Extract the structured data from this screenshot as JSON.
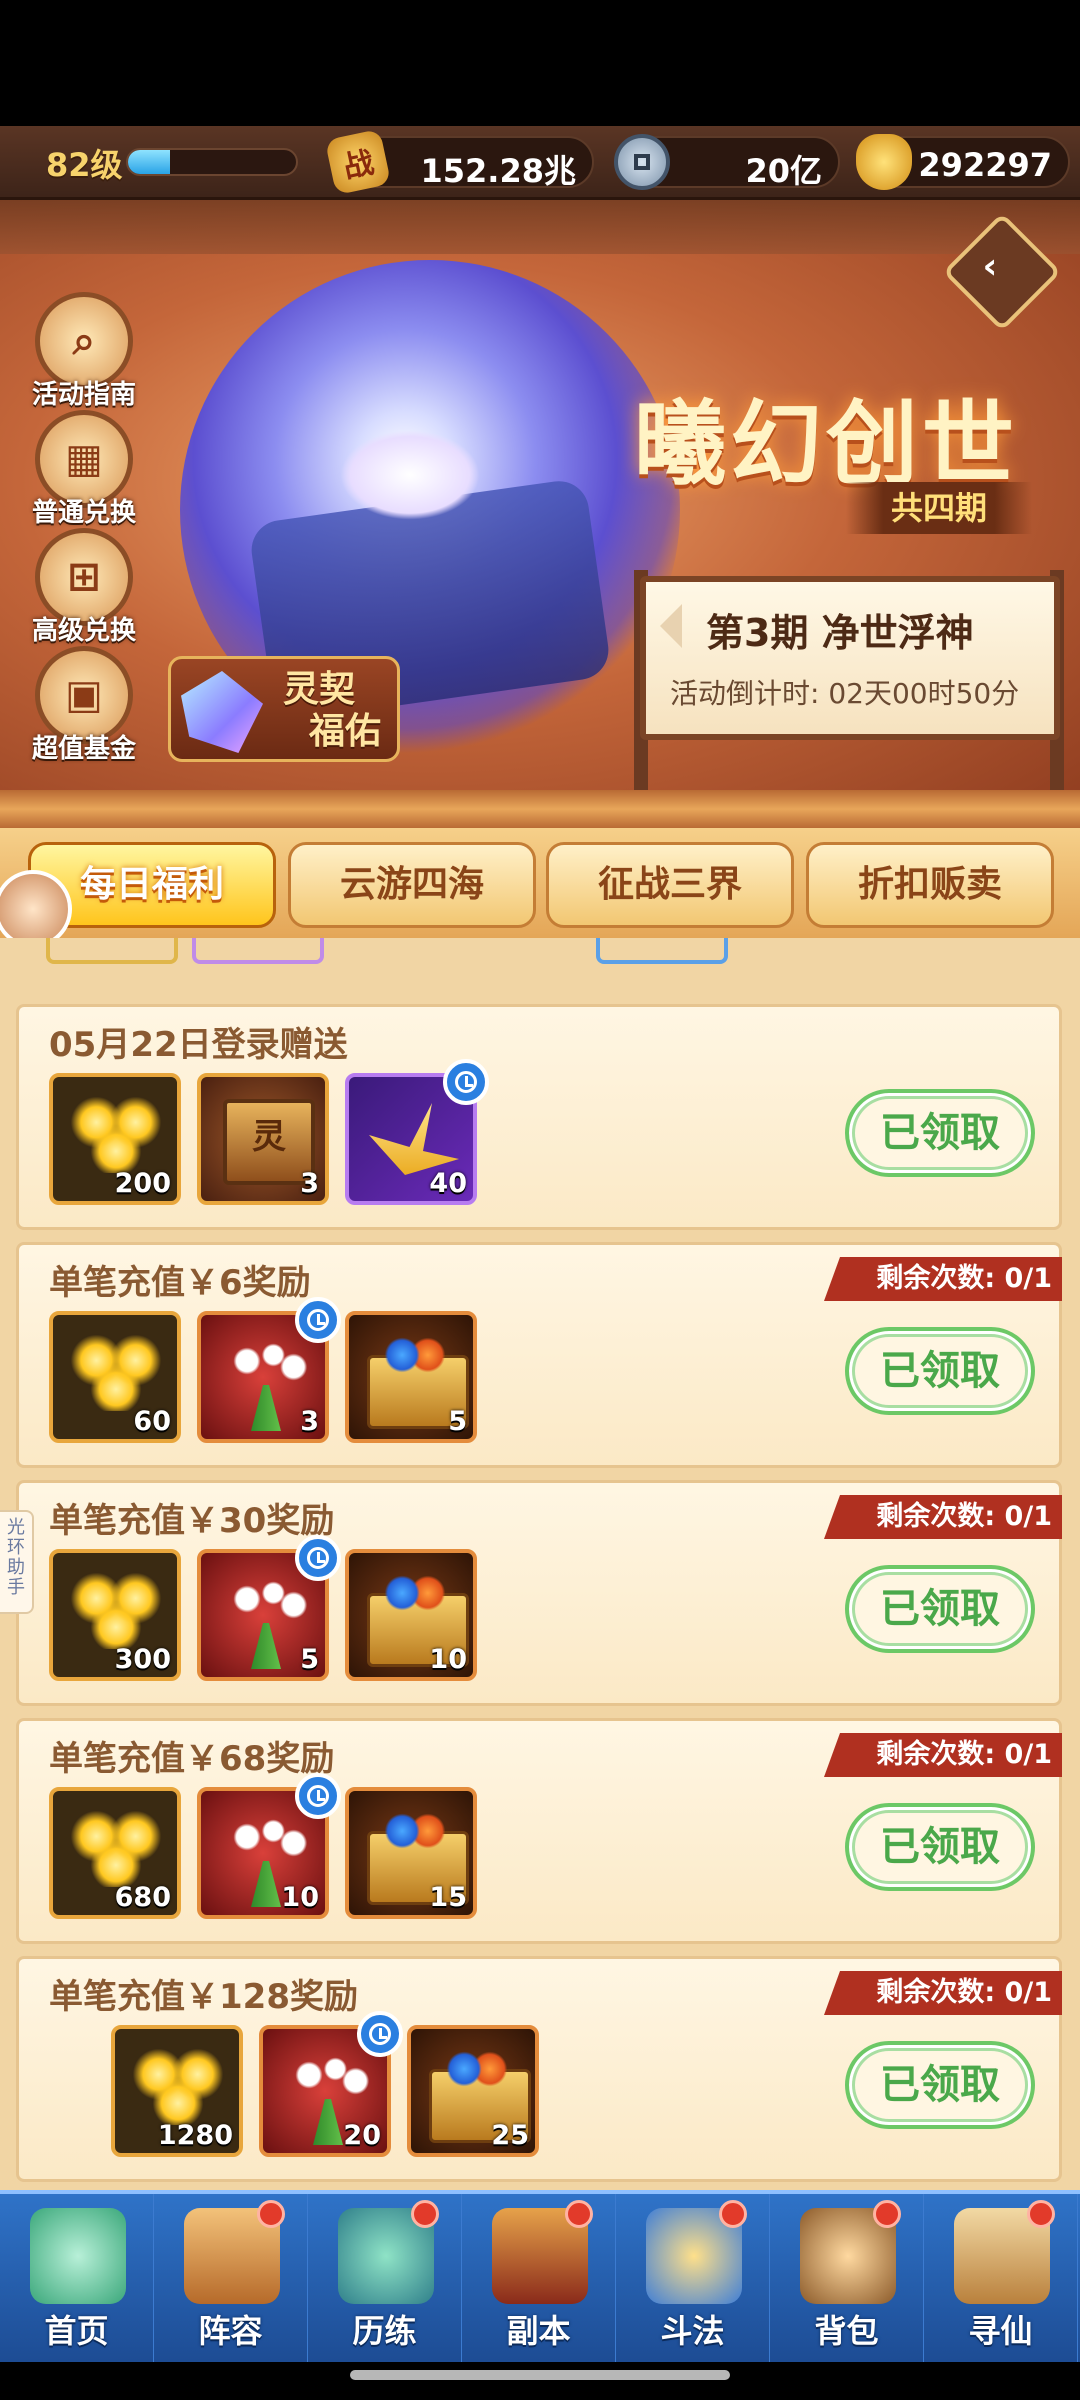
{
  "topbar": {
    "level": "82级",
    "level_progress": 0.25,
    "power_icon": "战",
    "power": "152.28兆",
    "coins": "20亿",
    "ingots": "292297"
  },
  "banner": {
    "title": "曦幻创世",
    "subtitle": "共四期",
    "period_title": "第3期  净世浮神",
    "countdown": "活动倒计时: 02天00时50分",
    "side_buttons": [
      {
        "label": "活动指南",
        "icon": "search-icon"
      },
      {
        "label": "普通兑换",
        "icon": "gift-box-icon"
      },
      {
        "label": "高级兑换",
        "icon": "gift-icon"
      },
      {
        "label": "超值基金",
        "icon": "chest-icon"
      }
    ],
    "lingqi_label_1": "灵契",
    "lingqi_label_2": "福佑"
  },
  "tabs": [
    {
      "label": "每日福利",
      "active": true
    },
    {
      "label": "云游四海",
      "active": false
    },
    {
      "label": "征战三界",
      "active": false
    },
    {
      "label": "折扣贩卖",
      "active": false
    }
  ],
  "side_assistant": "光环助手",
  "cards": [
    {
      "title": "05月22日登录赠送",
      "remaining": "",
      "claim": "已领取",
      "items": [
        {
          "type": "gold-ingot",
          "count": "200"
        },
        {
          "type": "spirit-chest",
          "count": "3"
        },
        {
          "type": "paper-crane",
          "count": "40",
          "timed": true
        }
      ]
    },
    {
      "title": "单笔充值￥6奖励",
      "remaining": "剩余次数: 0/1",
      "claim": "已领取",
      "items": [
        {
          "type": "gold-ingot",
          "count": "60"
        },
        {
          "type": "narcissus",
          "count": "3",
          "timed": true
        },
        {
          "type": "treasure-chest",
          "count": "5"
        }
      ]
    },
    {
      "title": "单笔充值￥30奖励",
      "remaining": "剩余次数: 0/1",
      "claim": "已领取",
      "items": [
        {
          "type": "gold-ingot",
          "count": "300"
        },
        {
          "type": "narcissus",
          "count": "5",
          "timed": true
        },
        {
          "type": "treasure-chest",
          "count": "10"
        }
      ]
    },
    {
      "title": "单笔充值￥68奖励",
      "remaining": "剩余次数: 0/1",
      "claim": "已领取",
      "items": [
        {
          "type": "gold-ingot",
          "count": "680"
        },
        {
          "type": "narcissus",
          "count": "10",
          "timed": true
        },
        {
          "type": "treasure-chest",
          "count": "15"
        }
      ]
    },
    {
      "title": "单笔充值￥128奖励",
      "remaining": "剩余次数: 0/1",
      "claim": "已领取",
      "items": [
        {
          "type": "gold-ingot",
          "count": "1280"
        },
        {
          "type": "narcissus",
          "count": "20",
          "timed": true
        },
        {
          "type": "treasure-chest",
          "count": "25"
        }
      ]
    }
  ],
  "bottom_nav": [
    {
      "label": "首页",
      "badge": false
    },
    {
      "label": "阵容",
      "badge": true
    },
    {
      "label": "历练",
      "badge": true
    },
    {
      "label": "副本",
      "badge": true
    },
    {
      "label": "斗法",
      "badge": true
    },
    {
      "label": "背包",
      "badge": true
    },
    {
      "label": "寻仙",
      "badge": true
    }
  ]
}
